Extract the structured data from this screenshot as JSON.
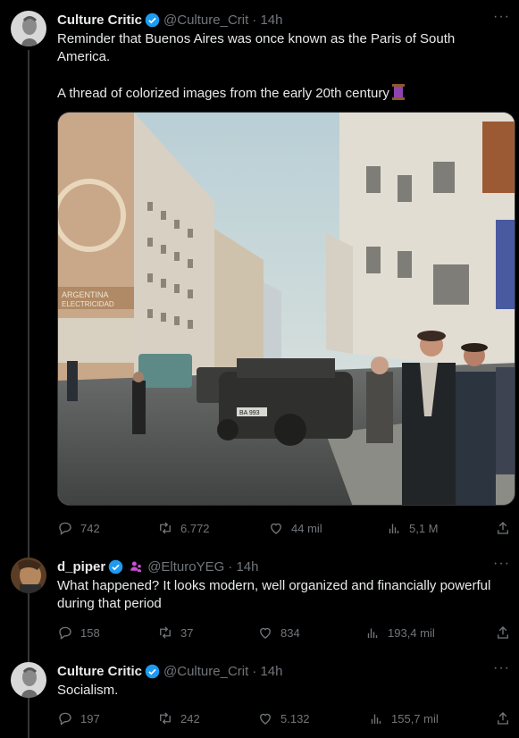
{
  "posts": [
    {
      "name": "Culture Critic",
      "handle": "@Culture_Crit",
      "time": "· 14h",
      "text": "Reminder that Buenos Aires was once known as the Paris of South America.\n\nA thread of colorized images from the early 20th century",
      "emoji": "spool-of-thread-emoji",
      "stats": {
        "replies": "742",
        "reposts": "6.772",
        "likes": "44 mil",
        "views": "5,1 M"
      },
      "image": {
        "sign_text_1": "ARGENTINA",
        "sign_text_2": "ELECTRICIDAD",
        "plate": "BA 993"
      }
    },
    {
      "name": "d_piper",
      "handle": "@ElturoYEG",
      "time": "· 14h",
      "text": "What happened? It looks modern, well organized and financially powerful during that period",
      "stats": {
        "replies": "158",
        "reposts": "37",
        "likes": "834",
        "views": "193,4 mil"
      }
    },
    {
      "name": "Culture Critic",
      "handle": "@Culture_Crit",
      "time": "· 14h",
      "text": "Socialism.",
      "stats": {
        "replies": "197",
        "reposts": "242",
        "likes": "5.132",
        "views": "155,7 mil"
      }
    }
  ],
  "more_label": "···",
  "colors": {
    "background": "#000000",
    "text": "#e7e9ea",
    "secondary": "#71767b",
    "verified": "#1d9bf0",
    "thread_line": "#333639"
  }
}
